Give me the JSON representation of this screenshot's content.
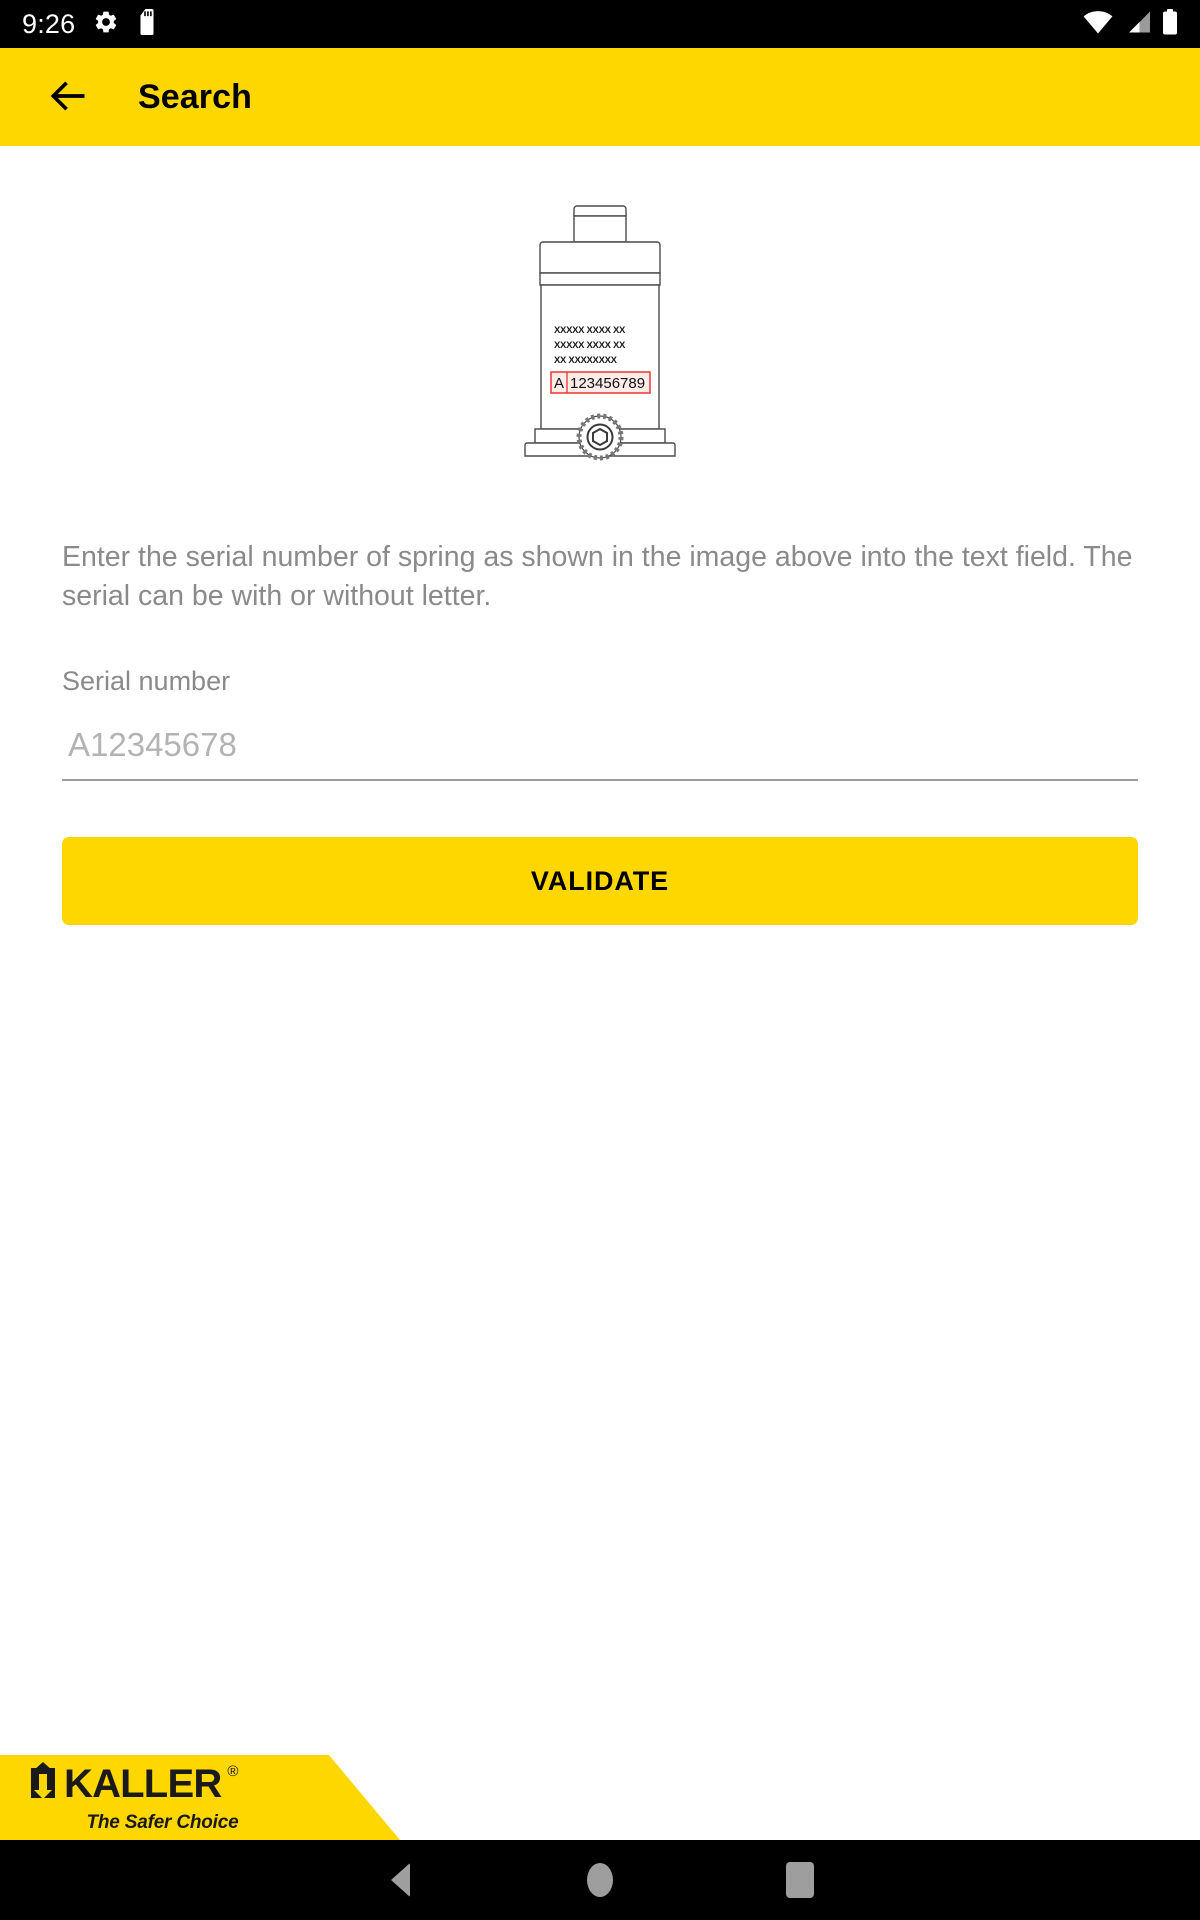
{
  "status_bar": {
    "time": "9:26",
    "icons_left": [
      "gear-icon",
      "sd-card-icon"
    ],
    "icons_right": [
      "wifi-icon",
      "cellular-signal-icon",
      "battery-icon"
    ]
  },
  "app_bar": {
    "back_icon": "arrow-left-icon",
    "title": "Search",
    "background_color": "#ffd700"
  },
  "illustration": {
    "name": "gas-spring-diagram",
    "marking_lines": [
      "XXXXX  XXXX XX",
      "XXXXX XXXX XX",
      "XX XXXXXXXX"
    ],
    "serial_letter": "A",
    "serial_digits": "123456789",
    "highlight_color": "#e8453c"
  },
  "main": {
    "description": "Enter the serial number of spring as shown in the image above into the text field. The serial can be with or without letter.",
    "field_label": "Serial number",
    "input_value": "",
    "input_placeholder": "A12345678",
    "validate_label": "VALIDATE"
  },
  "brand": {
    "name": "KALLER",
    "registered": "®",
    "tagline": "The Safer Choice",
    "banner_color": "#ffd700"
  },
  "nav_bar": {
    "items": [
      "back-triangle-icon",
      "home-circle-icon",
      "recents-square-icon"
    ]
  }
}
